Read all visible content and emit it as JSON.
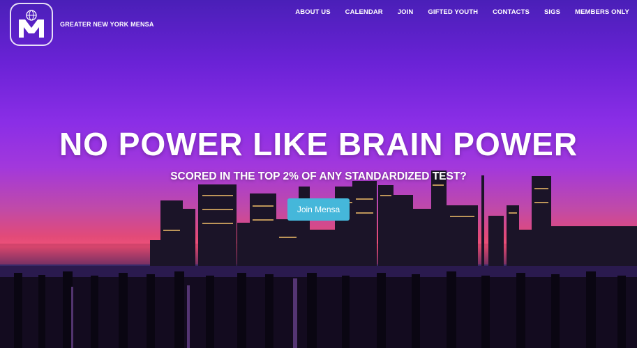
{
  "site": {
    "brand_name": "GREATER NEW YORK MENSA",
    "logo_icon": "mensa-logo-icon"
  },
  "nav": {
    "items": [
      {
        "label": "ABOUT US"
      },
      {
        "label": "CALENDAR"
      },
      {
        "label": "JOIN"
      },
      {
        "label": "GIFTED YOUTH"
      },
      {
        "label": "CONTACTS"
      },
      {
        "label": "SIGS"
      },
      {
        "label": "MEMBERS ONLY"
      }
    ]
  },
  "hero": {
    "headline": "NO POWER LIKE BRAIN POWER",
    "subheadline": "SCORED IN THE TOP 2% OF ANY STANDARDIZED TEST?",
    "cta_label": "Join Mensa",
    "cta_color": "#45b7da",
    "background": "purple-sunset-manhattan-skyline-photo"
  }
}
